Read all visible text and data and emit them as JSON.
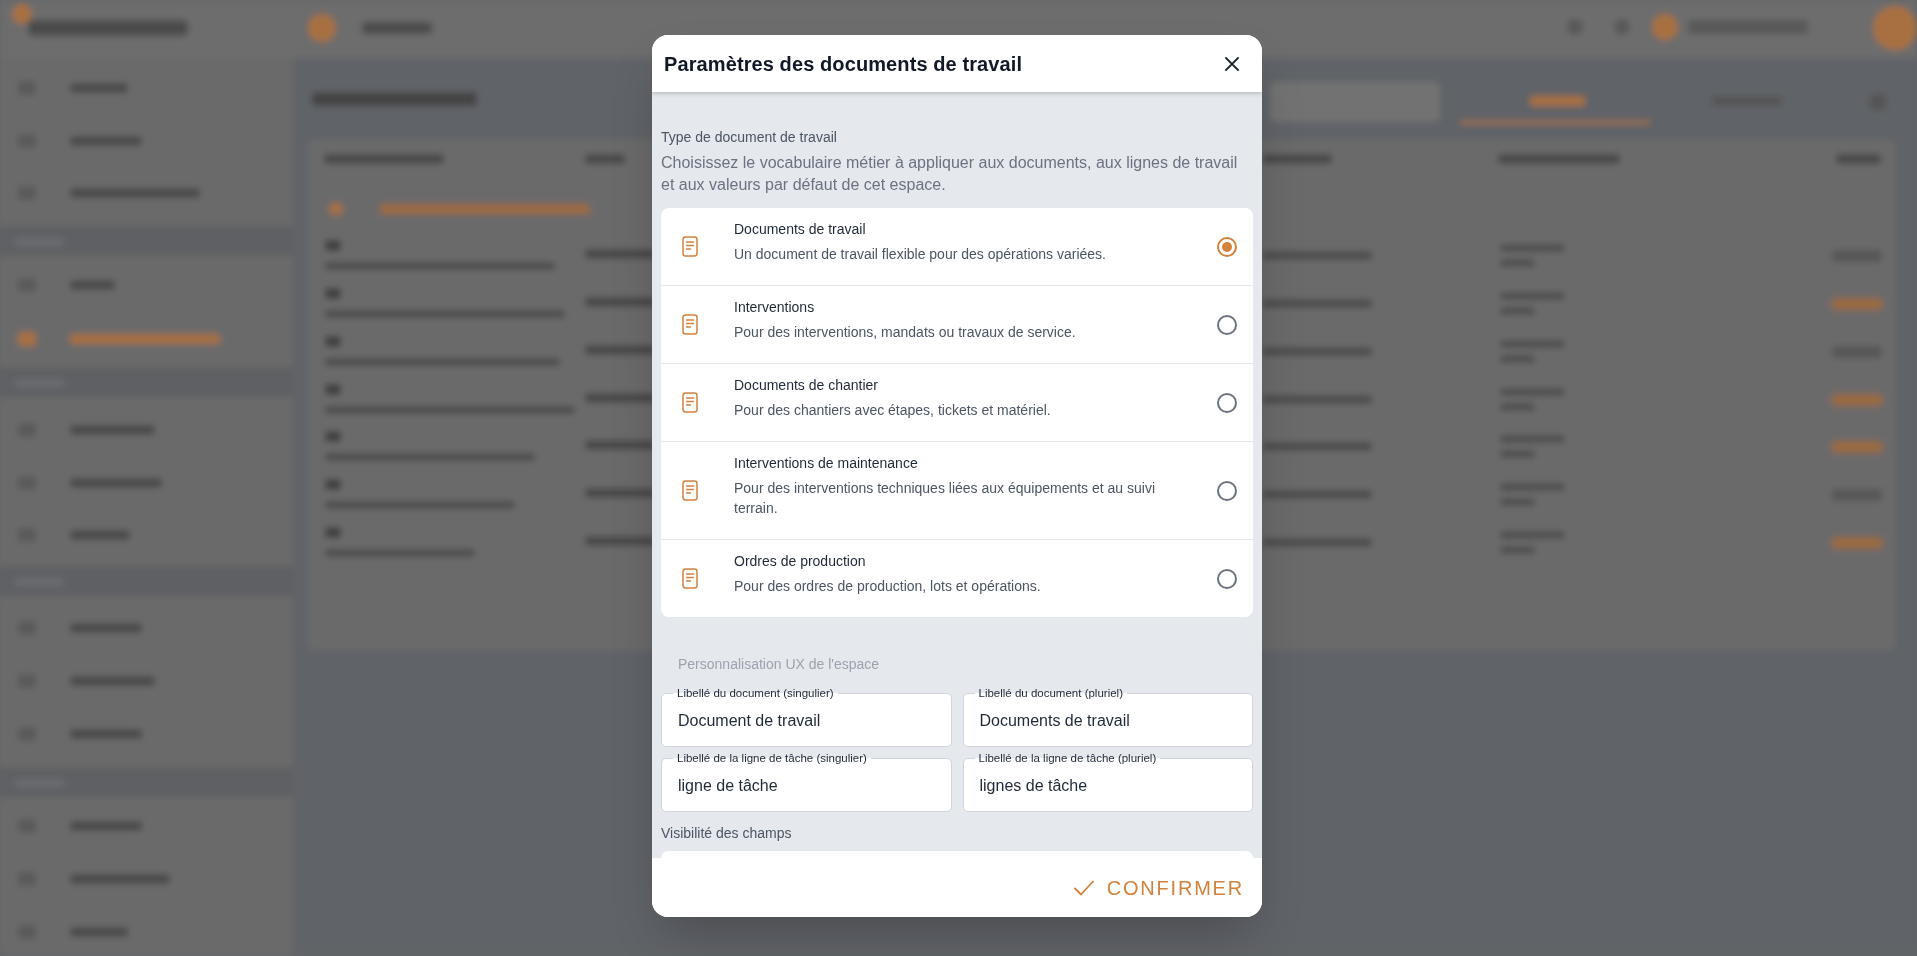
{
  "dialog": {
    "title": "Paramètres des documents de travail"
  },
  "document_type": {
    "label": "Type de document de travail",
    "description": "Choisissez le vocabulaire métier à appliquer aux documents, aux lignes de travail et aux valeurs par défaut de cet espace.",
    "options": [
      {
        "title": "Documents de travail",
        "description": "Un document de travail flexible pour des opérations variées.",
        "selected": true
      },
      {
        "title": "Interventions",
        "description": "Pour des interventions, mandats ou travaux de service.",
        "selected": false
      },
      {
        "title": "Documents de chantier",
        "description": "Pour des chantiers avec étapes, tickets et matériel.",
        "selected": false
      },
      {
        "title": "Interventions de maintenance",
        "description": "Pour des interventions techniques liées aux équipements et au suivi terrain.",
        "selected": false
      },
      {
        "title": "Ordres de production",
        "description": "Pour des ordres de production, lots et opérations.",
        "selected": false
      }
    ]
  },
  "ux_customization": {
    "heading": "Personnalisation UX de l'espace",
    "fields": [
      {
        "label": "Libellé du document (singulier)",
        "value": "Document de travail"
      },
      {
        "label": "Libellé du document (pluriel)",
        "value": "Documents de travail"
      },
      {
        "label": "Libellé de la ligne de tâche (singulier)",
        "value": "ligne de tâche"
      },
      {
        "label": "Libellé de la ligne de tâche (pluriel)",
        "value": "lignes de tâche"
      }
    ]
  },
  "field_visibility": {
    "heading": "Visibilité des champs"
  },
  "footer": {
    "confirm_label": "CONFIRMER"
  }
}
